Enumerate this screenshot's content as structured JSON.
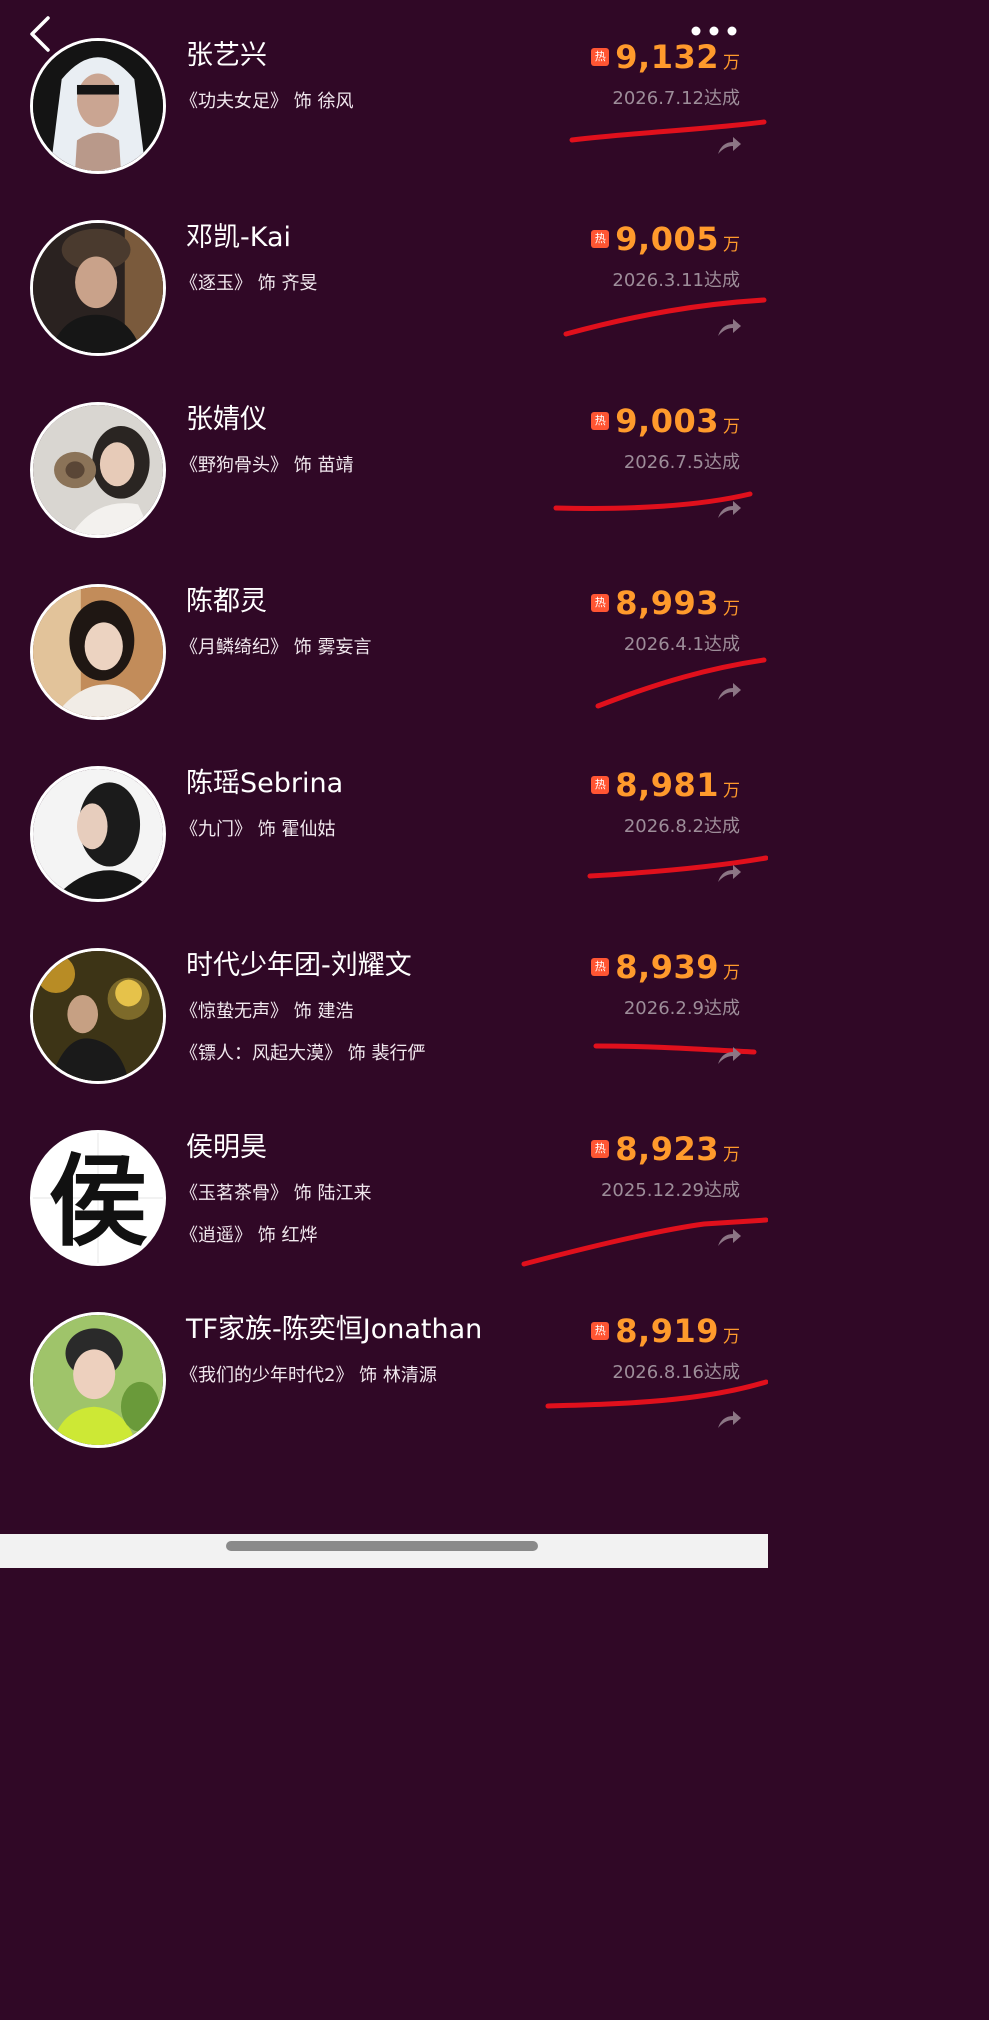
{
  "header": {
    "back_icon": "chevron-left-icon",
    "more_icon": "more-horizontal-icon"
  },
  "colors": {
    "background": "#300826",
    "heat_value": "#ff9a2c",
    "hot_badge": "#ff5533",
    "annotation_line": "#e0101c"
  },
  "hot_badge_label": "热",
  "heat_unit": "万",
  "role_connector": "饰",
  "entries": [
    {
      "name": "张艺兴",
      "roles": [
        "《功夫女足》 饰 徐风"
      ],
      "heat": "9,132",
      "date": "2026.7.12达成"
    },
    {
      "name": "邓凯-Kai",
      "roles": [
        "《逐玉》 饰 齐旻"
      ],
      "heat": "9,005",
      "date": "2026.3.11达成"
    },
    {
      "name": "张婧仪",
      "roles": [
        "《野狗骨头》 饰 苗靖"
      ],
      "heat": "9,003",
      "date": "2026.7.5达成"
    },
    {
      "name": "陈都灵",
      "roles": [
        "《月鳞绮纪》 饰 雾妄言"
      ],
      "heat": "8,993",
      "date": "2026.4.1达成"
    },
    {
      "name": "陈瑶Sebrina",
      "roles": [
        "《九门》 饰 霍仙姑"
      ],
      "heat": "8,981",
      "date": "2026.8.2达成"
    },
    {
      "name": "时代少年团-刘耀文",
      "roles": [
        "《惊蛰无声》 饰 建浩",
        "《镖人：风起大漠》 饰 裴行俨"
      ],
      "heat": "8,939",
      "date": "2026.2.9达成"
    },
    {
      "name": "侯明昊",
      "roles": [
        "《玉茗茶骨》 饰 陆江来",
        "《逍遥》 饰 红烨"
      ],
      "heat": "8,923",
      "date": "2025.12.29达成",
      "avatar_char": "侯"
    },
    {
      "name": "TF家族-陈奕恒Jonathan",
      "roles": [
        "《我们的少年时代2》 饰 林清源"
      ],
      "heat": "8,919",
      "date": "2026.8.16达成"
    }
  ]
}
